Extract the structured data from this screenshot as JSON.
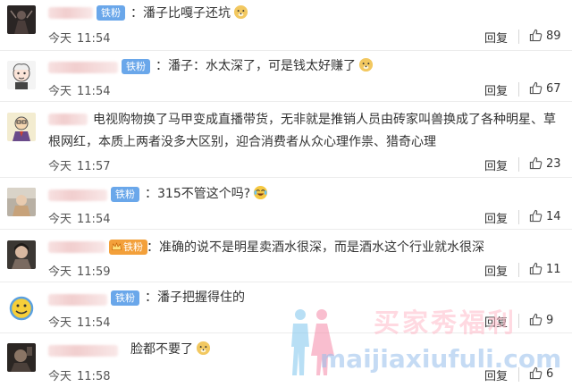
{
  "colors": {
    "badge": "#6aa7ea",
    "badge_crown": "#f3a03a",
    "text": "#333333",
    "meta": "#555555",
    "divider": "#ececec"
  },
  "comments": [
    {
      "avatar": "dark-figure-avatar",
      "badge": "铁粉",
      "text": "：潘子比嘎子还坑",
      "emoji": "doge-emoji",
      "day": "今天",
      "time": "11:54",
      "reply": "回复",
      "likes": "89"
    },
    {
      "avatar": "cartoon-face-avatar",
      "badge": "铁粉",
      "text": "：潘子：水太深了，可是钱太好赚了",
      "emoji": "doge-emoji",
      "day": "今天",
      "time": "11:54",
      "reply": "回复",
      "likes": "67"
    },
    {
      "avatar": "cartoon-man-avatar",
      "badge": "",
      "text": "电视购物换了马甲变成直播带货，无非就是推销人员由砖家叫兽换成了各种明星、草根网红，本质上两者没多大区别，迎合消费者从众心理作祟、猎奇心理",
      "emoji": "",
      "day": "今天",
      "time": "11:57",
      "reply": "回复",
      "likes": "23"
    },
    {
      "avatar": "photo-avatar",
      "badge": "铁粉",
      "text": "：315不管这个吗?",
      "emoji": "laugh-cry-emoji",
      "day": "今天",
      "time": "11:54",
      "reply": "回复",
      "likes": "14"
    },
    {
      "avatar": "portrait-avatar",
      "badge": "铁粉",
      "text": "：准确的说不是明星卖酒水很深，而是酒水这个行业就水很深",
      "emoji": "",
      "day": "今天",
      "time": "11:59",
      "reply": "回复",
      "likes": "11"
    },
    {
      "avatar": "smiley-avatar",
      "badge": "铁粉",
      "text": "：潘子把握得住的",
      "emoji": "",
      "day": "今天",
      "time": "11:54",
      "reply": "回复",
      "likes": "9"
    },
    {
      "avatar": "dark-photo-avatar",
      "badge": "",
      "text": "脸都不要了",
      "emoji": "doge-emoji",
      "day": "今天",
      "time": "11:58",
      "reply": "回复",
      "likes": "6"
    }
  ],
  "watermark": {
    "cn": "买家秀福利",
    "en": "maijiaxiufuli.com"
  }
}
